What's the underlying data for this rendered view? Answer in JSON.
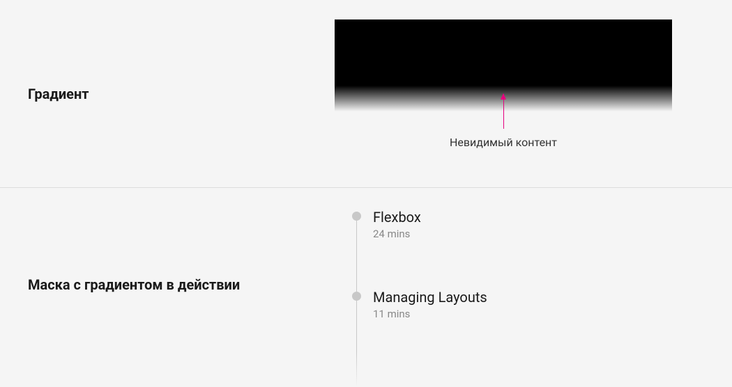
{
  "top": {
    "label": "Градиент",
    "caption": "Невидимый контент"
  },
  "bottom": {
    "label": "Маска с градиентом в действии",
    "items": [
      {
        "title": "Flexbox",
        "sub": "24 mins"
      },
      {
        "title": "Managing Layouts",
        "sub": "11 mins"
      }
    ]
  }
}
